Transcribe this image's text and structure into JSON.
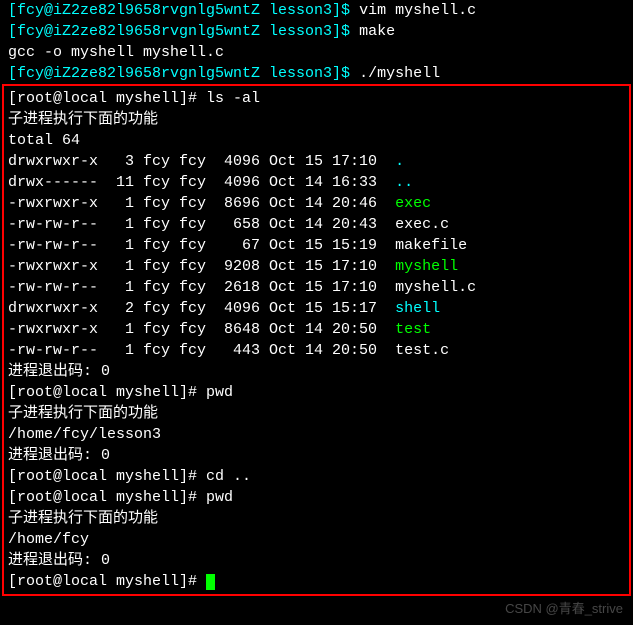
{
  "pre_lines": [
    {
      "segs": [
        {
          "t": "[fcy@iZ2ze82l9658rvgnlg5wntZ lesson3]$ ",
          "c": "cyan"
        },
        {
          "t": "vim myshell.c"
        }
      ]
    },
    {
      "segs": [
        {
          "t": "[fcy@iZ2ze82l9658rvgnlg5wntZ lesson3]$ ",
          "c": "cyan"
        },
        {
          "t": "make"
        }
      ]
    },
    {
      "segs": [
        {
          "t": "gcc -o myshell myshell.c"
        }
      ]
    },
    {
      "segs": [
        {
          "t": "[fcy@iZ2ze82l9658rvgnlg5wntZ lesson3]$ ",
          "c": "cyan"
        },
        {
          "t": "./myshell"
        }
      ]
    }
  ],
  "box_lines": [
    {
      "segs": [
        {
          "t": "[root@local myshell]# ls -al"
        }
      ]
    },
    {
      "segs": [
        {
          "t": "子进程执行下面的功能"
        }
      ]
    },
    {
      "segs": [
        {
          "t": "total 64"
        }
      ]
    },
    {
      "segs": [
        {
          "t": "drwxrwxr-x   3 fcy fcy  4096 Oct 15 17:10  "
        },
        {
          "t": ".",
          "c": "cyan"
        }
      ]
    },
    {
      "segs": [
        {
          "t": "drwx------  11 fcy fcy  4096 Oct 14 16:33  "
        },
        {
          "t": "..",
          "c": "cyan"
        }
      ]
    },
    {
      "segs": [
        {
          "t": "-rwxrwxr-x   1 fcy fcy  8696 Oct 14 20:46  "
        },
        {
          "t": "exec",
          "c": "green"
        }
      ]
    },
    {
      "segs": [
        {
          "t": "-rw-rw-r--   1 fcy fcy   658 Oct 14 20:43  exec.c"
        }
      ]
    },
    {
      "segs": [
        {
          "t": "-rw-rw-r--   1 fcy fcy    67 Oct 15 15:19  makefile"
        }
      ]
    },
    {
      "segs": [
        {
          "t": "-rwxrwxr-x   1 fcy fcy  9208 Oct 15 17:10  "
        },
        {
          "t": "myshell",
          "c": "green"
        }
      ]
    },
    {
      "segs": [
        {
          "t": "-rw-rw-r--   1 fcy fcy  2618 Oct 15 17:10  myshell.c"
        }
      ]
    },
    {
      "segs": [
        {
          "t": "drwxrwxr-x   2 fcy fcy  4096 Oct 15 15:17  "
        },
        {
          "t": "shell",
          "c": "cyan"
        }
      ]
    },
    {
      "segs": [
        {
          "t": "-rwxrwxr-x   1 fcy fcy  8648 Oct 14 20:50  "
        },
        {
          "t": "test",
          "c": "green"
        }
      ]
    },
    {
      "segs": [
        {
          "t": "-rw-rw-r--   1 fcy fcy   443 Oct 14 20:50  test.c"
        }
      ]
    },
    {
      "segs": [
        {
          "t": "进程退出码: 0"
        }
      ]
    },
    {
      "segs": [
        {
          "t": "[root@local myshell]# pwd"
        }
      ]
    },
    {
      "segs": [
        {
          "t": "子进程执行下面的功能"
        }
      ]
    },
    {
      "segs": [
        {
          "t": "/home/fcy/lesson3"
        }
      ]
    },
    {
      "segs": [
        {
          "t": "进程退出码: 0"
        }
      ]
    },
    {
      "segs": [
        {
          "t": "[root@local myshell]# cd .."
        }
      ]
    },
    {
      "segs": [
        {
          "t": "[root@local myshell]# pwd"
        }
      ]
    },
    {
      "segs": [
        {
          "t": "子进程执行下面的功能"
        }
      ]
    },
    {
      "segs": [
        {
          "t": "/home/fcy"
        }
      ]
    },
    {
      "segs": [
        {
          "t": "进程退出码: 0"
        }
      ]
    },
    {
      "segs": [
        {
          "t": "[root@local myshell]# "
        }
      ],
      "cursor": true
    }
  ],
  "watermark": "CSDN @青春_strive"
}
